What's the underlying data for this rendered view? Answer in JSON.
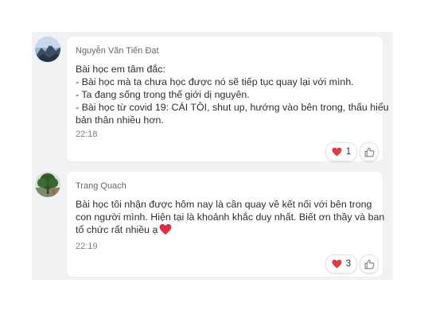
{
  "comments": [
    {
      "author": "Nguyễn Văn Tiến Đạt",
      "lines": [
        "Bài học em tâm đắc:",
        "- Bài học mà ta chưa học được nó sẽ tiếp tục quay lại với mình.",
        "- Ta đang sống trong thế giới dị nguyên.",
        "- Bài học từ covid 19: CÁI TÔI, shut up, hướng vào bên trong, thấu hiểu",
        "bản thân nhiều hơn."
      ],
      "time": "22:18",
      "reaction_icon": "heart-emoji",
      "reaction_count": "1",
      "avatar_icon": "mountain-photo"
    },
    {
      "author": "Trang Quach",
      "lines": [
        "Bài học tôi nhận được hôm nay là cần quay về kết nối với bên trong",
        "con người mình. Hiện tại là khoảnh khắc duy nhất. Biết ơn thầy và ban",
        "tổ chức rất nhiều ạ"
      ],
      "time": "22:19",
      "reaction_icon": "heart-emoji",
      "reaction_count": "3",
      "avatar_icon": "tree-photo"
    }
  ],
  "colors": {
    "panel_bg": "#f1f2f4",
    "bubble_bg": "#ffffff",
    "heart": "#e03a45",
    "like_outline": "#6b7280"
  }
}
